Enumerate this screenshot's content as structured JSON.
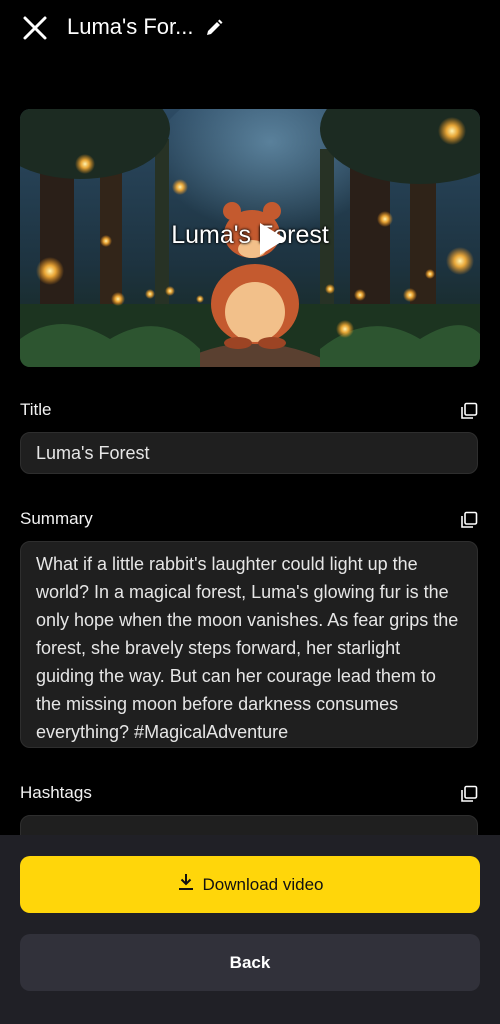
{
  "header": {
    "title": "Luma's For...",
    "close_icon": "close-icon",
    "edit_icon": "pencil-icon"
  },
  "video": {
    "overlay_title": "Luma's Forest",
    "play_icon": "play-icon"
  },
  "fields": {
    "title_label": "Title",
    "title_value": "Luma's Forest",
    "summary_label": "Summary",
    "summary_value": "What if a little rabbit's laughter could light up the world? In a magical forest, Luma's glowing fur is the only hope when the moon vanishes. As fear grips the forest, she bravely steps forward, her starlight guiding the way. But can her courage lead them to the missing moon before darkness consumes everything? #MagicalAdventure",
    "hashtags_label": "Hashtags",
    "copy_icon": "copy-icon"
  },
  "actions": {
    "download_label": "Download video",
    "download_icon": "download-icon",
    "back_label": "Back"
  },
  "colors": {
    "accent": "#ffd60a",
    "background": "#000000",
    "panel": "#202026",
    "field": "#1f1f1f"
  }
}
